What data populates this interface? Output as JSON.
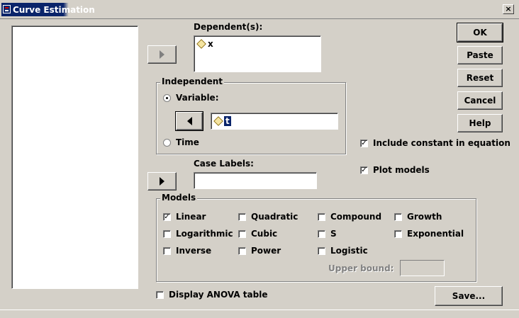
{
  "window": {
    "title": "Curve Estimation",
    "close": "×"
  },
  "labels": {
    "dependents": "Dependent(s):",
    "independent": "Independent",
    "variable": "Variable:",
    "time": "Time",
    "case_labels": "Case Labels:",
    "models": "Models",
    "upper_bound": "Upper bound:"
  },
  "dependent_list": [
    {
      "name": "x",
      "icon": "variable-icon"
    }
  ],
  "independent_variable": {
    "name": "t",
    "icon": "variable-icon"
  },
  "independent_mode": "variable",
  "buttons": {
    "ok": "OK",
    "paste": "Paste",
    "reset": "Reset",
    "cancel": "Cancel",
    "help": "Help",
    "save": "Save..."
  },
  "options": {
    "include_constant": {
      "label": "Include constant in equation",
      "checked": true
    },
    "plot_models": {
      "label": "Plot models",
      "checked": true
    },
    "display_anova": {
      "label": "Display ANOVA table",
      "checked": false
    }
  },
  "models": [
    {
      "label": "Linear",
      "checked": true
    },
    {
      "label": "Quadratic",
      "checked": false
    },
    {
      "label": "Compound",
      "checked": false
    },
    {
      "label": "Growth",
      "checked": false
    },
    {
      "label": "Logarithmic",
      "checked": false
    },
    {
      "label": "Cubic",
      "checked": false
    },
    {
      "label": "S",
      "checked": false
    },
    {
      "label": "Exponential",
      "checked": false
    },
    {
      "label": "Inverse",
      "checked": false
    },
    {
      "label": "Power",
      "checked": false
    },
    {
      "label": "Logistic",
      "checked": false
    }
  ],
  "upper_bound_value": ""
}
